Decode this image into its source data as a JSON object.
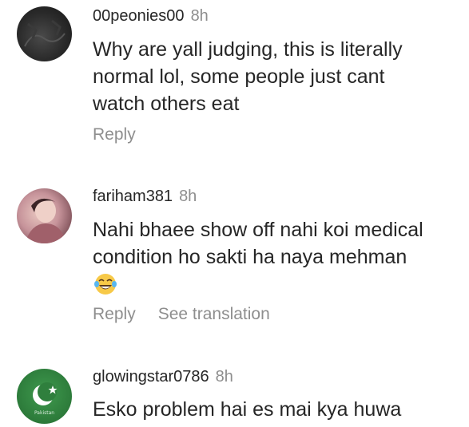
{
  "comments": [
    {
      "username": "00peonies00",
      "time": "8h",
      "lines": [
        "Why are yall judging, this is literally",
        "normal lol, some people just cant",
        "watch others eat"
      ],
      "actions": [
        "Reply"
      ]
    },
    {
      "username": "fariham381",
      "time": "8h",
      "lines": [
        "Nahi bhaee show off nahi koi medical",
        "condition ho sakti ha naya mehman"
      ],
      "emoji": "laughing-tears-emoji",
      "actions": [
        "Reply",
        "See translation"
      ]
    },
    {
      "username": "glowingstar0786",
      "time": "8h",
      "lines": [
        "Esko problem hai es mai kya huwa"
      ],
      "avatar_caption": "Pakistan",
      "actions": []
    }
  ],
  "colors": {
    "text": "#262626",
    "muted": "#8e8e8e",
    "flag_green": "#2f7f3d"
  }
}
